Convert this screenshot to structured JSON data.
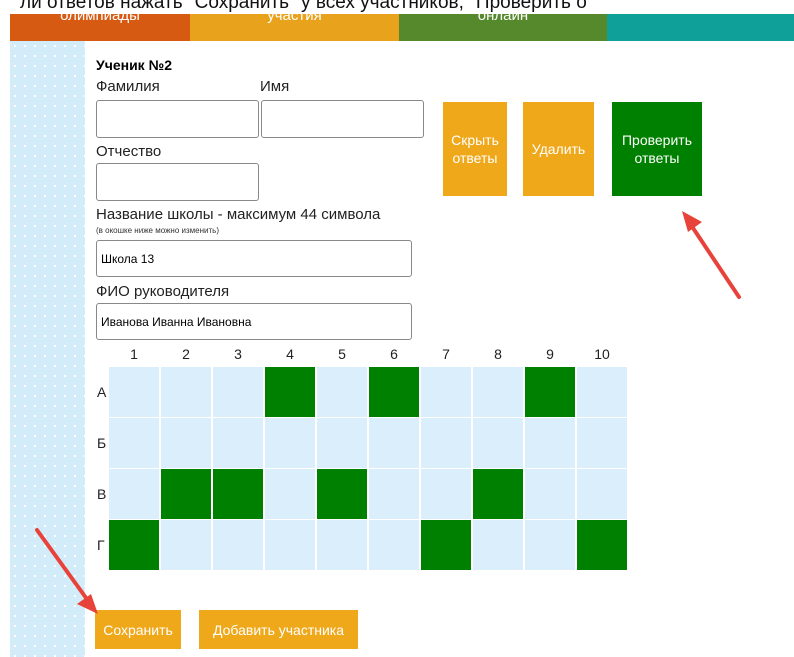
{
  "caption_partial": "ли ответов нажать \"Сохранить\" у всех участников, \"Проверить о",
  "nav": {
    "tabs": [
      {
        "label": "олимпиады",
        "color": "#d75a12",
        "width": 180
      },
      {
        "label": "участия",
        "color": "#e9a21b",
        "width": 209
      },
      {
        "label": "онлайн",
        "color": "#55892b",
        "width": 208
      },
      {
        "label": "",
        "color": "#10a09a",
        "width": 187
      }
    ]
  },
  "student": {
    "heading": "Ученик №2",
    "surname_label": "Фамилия",
    "name_label": "Имя",
    "patronymic_label": "Отчество",
    "surname_value": "",
    "name_value": "",
    "patronymic_value": "",
    "school_label_bold": "Название школы -",
    "school_label_rest": " максимум 44 символа",
    "school_hint": "(в окошке ниже можно изменить)",
    "school_value": "Школа 13",
    "teacher_label": "ФИО руководителя",
    "teacher_value": "Иванова Иванна Ивановна"
  },
  "buttons": {
    "hide_answers": "Скрыть ответы",
    "delete": "Удалить",
    "check_answers": "Проверить ответы",
    "save": "Сохранить",
    "add_participant": "Добавить участника"
  },
  "grid": {
    "columns": [
      "1",
      "2",
      "3",
      "4",
      "5",
      "6",
      "7",
      "8",
      "9",
      "10"
    ],
    "rows": [
      {
        "label": "А",
        "selected": [
          4,
          6,
          9
        ]
      },
      {
        "label": "Б",
        "selected": []
      },
      {
        "label": "В",
        "selected": [
          2,
          3,
          5,
          8
        ]
      },
      {
        "label": "Г",
        "selected": [
          1,
          7,
          10
        ]
      }
    ]
  },
  "colors": {
    "selected": "#008000",
    "unselected": "#dbeefb",
    "button_orange": "#f0a81b",
    "button_green": "#008000",
    "arrow": "#e8433a"
  }
}
